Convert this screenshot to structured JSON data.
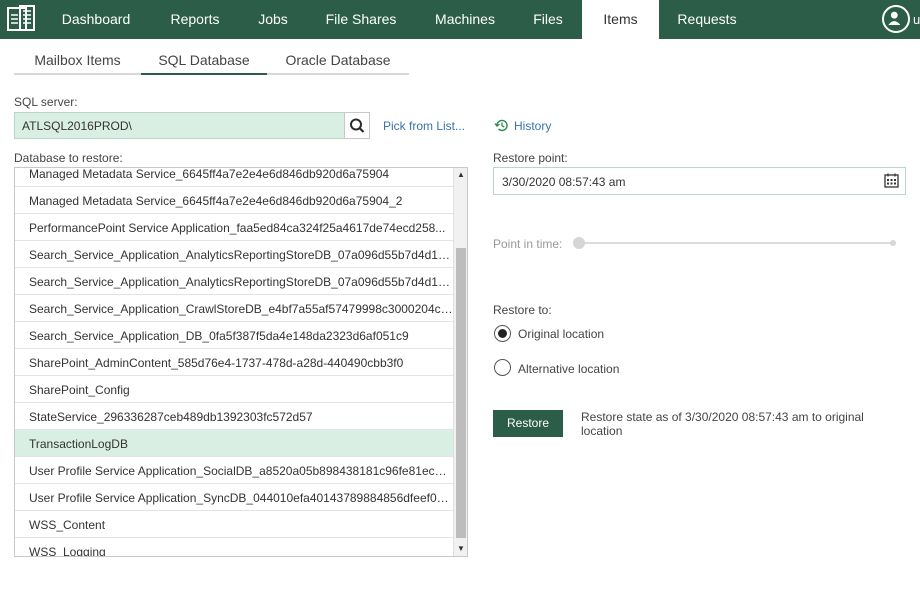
{
  "nav": {
    "items": [
      {
        "label": "Dashboard"
      },
      {
        "label": "Reports"
      },
      {
        "label": "Jobs"
      },
      {
        "label": "File Shares"
      },
      {
        "label": "Machines"
      },
      {
        "label": "Files"
      },
      {
        "label": "Items",
        "active": true
      },
      {
        "label": "Requests"
      }
    ],
    "user_initial": "u"
  },
  "subtabs": [
    {
      "label": "Mailbox Items"
    },
    {
      "label": "SQL Database",
      "active": true
    },
    {
      "label": "Oracle Database"
    }
  ],
  "sql_server": {
    "label": "SQL server:",
    "value": "ATLSQL2016PROD\\",
    "pick_link": "Pick from List...",
    "history_link": "History"
  },
  "database": {
    "label": "Database to restore:",
    "items": [
      "Managed Metadata Service_6645ff4a7e2e4e6d846db920d6a75904",
      "Managed Metadata Service_6645ff4a7e2e4e6d846db920d6a75904_2",
      "PerformancePoint Service Application_faa5ed84ca324f25a4617de74ecd258...",
      "Search_Service_Application_AnalyticsReportingStoreDB_07a096d55b7d4d18...",
      "Search_Service_Application_AnalyticsReportingStoreDB_07a096d55b7d4d18...",
      "Search_Service_Application_CrawlStoreDB_e4bf7a55af57479998c3000204c1...",
      "Search_Service_Application_DB_0fa5f387f5da4e148da2323d6af051c9",
      "SharePoint_AdminContent_585d76e4-1737-478d-a28d-440490cbb3f0",
      "SharePoint_Config",
      "StateService_296336287ceb489db1392303fc572d57",
      "TransactionLogDB",
      "User Profile Service Application_SocialDB_a8520a05b898438181c96fe81ecbc...",
      "User Profile Service Application_SyncDB_044010efa40143789884856dfeef09...",
      "WSS_Content",
      "WSS_Logging"
    ],
    "selected": "TransactionLogDB"
  },
  "restore_point": {
    "label": "Restore point:",
    "value": "3/30/2020 08:57:43 am"
  },
  "point_in_time": {
    "label": "Point in time:",
    "position": 0
  },
  "restore_to": {
    "label": "Restore to:",
    "options": [
      {
        "label": "Original location",
        "checked": true
      },
      {
        "label": "Alternative location",
        "checked": false
      }
    ]
  },
  "restore": {
    "button_label": "Restore",
    "state_text": "Restore state as of 3/30/2020 08:57:43 am to original location"
  },
  "colors": {
    "brand": "#2b5d48",
    "selection": "#d9efe4",
    "link": "#3a73a8"
  }
}
